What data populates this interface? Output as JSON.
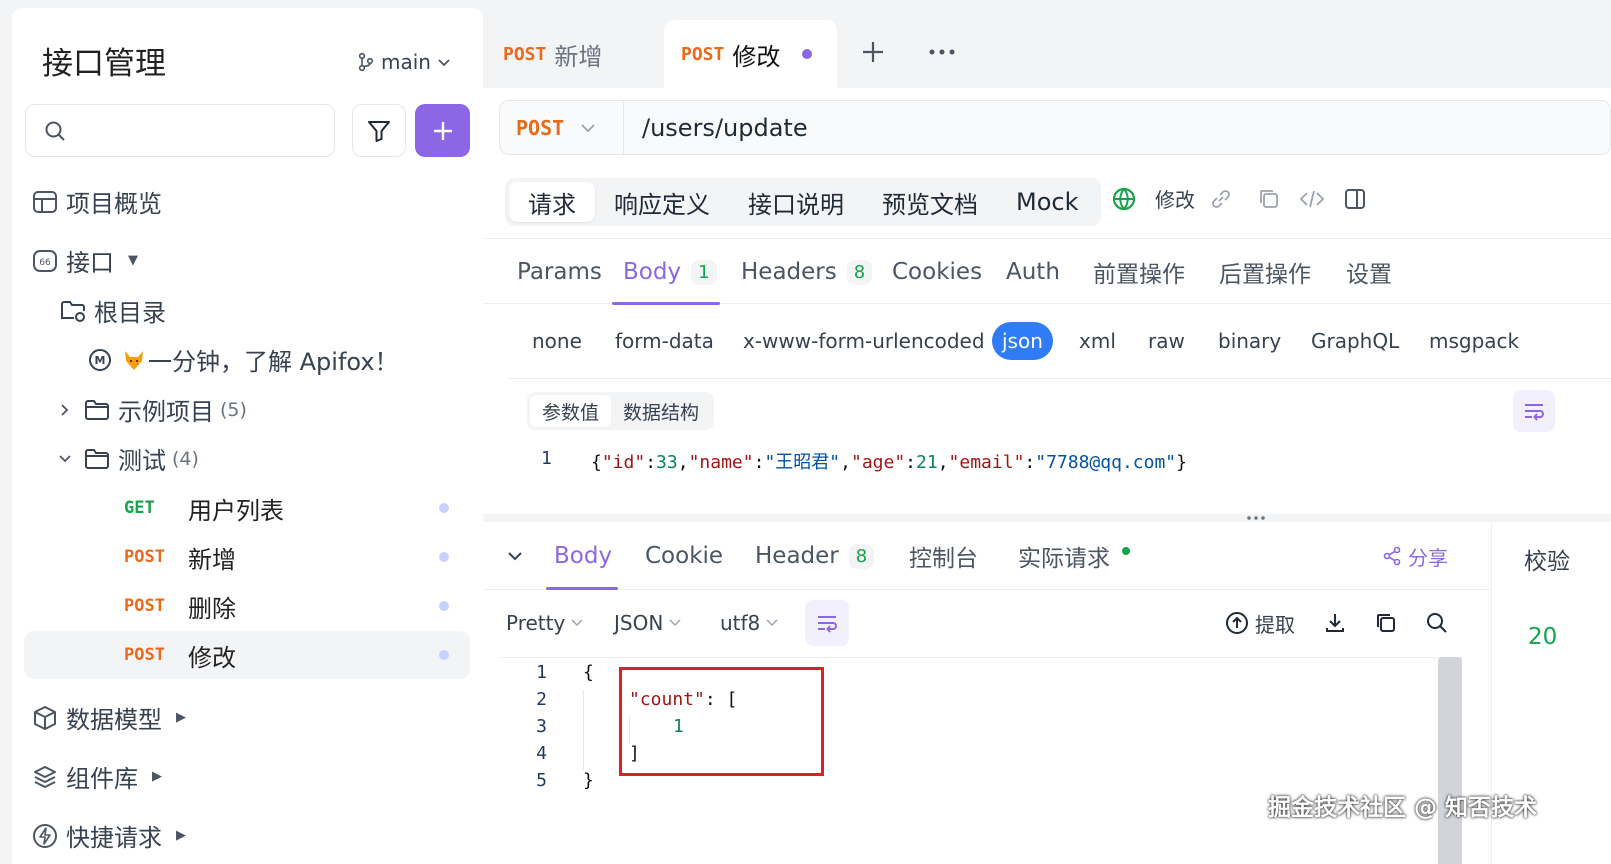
{
  "sidebar": {
    "title": "接口管理",
    "branch": "main",
    "search_placeholder": "",
    "overview": "项目概览",
    "interfaces": "接口",
    "root": "根目录",
    "intro_doc": "一分钟，了解 Apifox！",
    "folder_example": {
      "label": "示例项目",
      "count": "(5)"
    },
    "folder_test": {
      "label": "测试",
      "count": "(4)"
    },
    "apis": [
      {
        "method": "GET",
        "name": "用户列表"
      },
      {
        "method": "POST",
        "name": "新增"
      },
      {
        "method": "POST",
        "name": "删除"
      },
      {
        "method": "POST",
        "name": "修改"
      }
    ],
    "data_models": "数据模型",
    "components": "组件库",
    "quick_request": "快捷请求"
  },
  "tabs": [
    {
      "method": "POST",
      "name": "新增"
    },
    {
      "method": "POST",
      "name": "修改"
    }
  ],
  "request": {
    "method": "POST",
    "url": "/users/update"
  },
  "mode_tabs": [
    "请求",
    "响应定义",
    "接口说明",
    "预览文档",
    "Mock"
  ],
  "toolbar": {
    "edit_label": "修改"
  },
  "sub_tabs": {
    "params": "Params",
    "body": "Body",
    "body_count": "1",
    "headers": "Headers",
    "headers_count": "8",
    "cookies": "Cookies",
    "auth": "Auth",
    "pre": "前置操作",
    "post": "后置操作",
    "settings": "设置"
  },
  "body_types": [
    "none",
    "form-data",
    "x-www-form-urlencoded",
    "json",
    "xml",
    "raw",
    "binary",
    "GraphQL",
    "msgpack"
  ],
  "body_view": {
    "values": "参数值",
    "schema": "数据结构"
  },
  "body_code": {
    "line_no": "1",
    "k_id": "\"id\"",
    "v_id": "33",
    "k_name": "\"name\"",
    "v_name": "\"王昭君\"",
    "k_age": "\"age\"",
    "v_age": "21",
    "k_email": "\"email\"",
    "v_email": "\"7788@qq.com\""
  },
  "response": {
    "tabs": {
      "body": "Body",
      "cookie": "Cookie",
      "header": "Header",
      "header_count": "8",
      "console": "控制台",
      "actual": "实际请求"
    },
    "share": "分享",
    "side_title": "校验",
    "side_value": "20",
    "format": {
      "pretty": "Pretty",
      "json": "JSON",
      "encoding": "utf8"
    },
    "extract": "提取",
    "lines": [
      "1",
      "2",
      "3",
      "4",
      "5"
    ],
    "code": {
      "open": "{",
      "key": "\"count\"",
      "colon": ": [",
      "value": "1",
      "close_arr": "]",
      "close": "}"
    }
  },
  "watermark": "掘金技术社区 @ 知否技术",
  "colors": {
    "accent": "#8b67e6",
    "post": "#ea6a1a",
    "get": "#16a34a",
    "json_btn": "#2f7cf6",
    "highlight": "#e02020"
  }
}
